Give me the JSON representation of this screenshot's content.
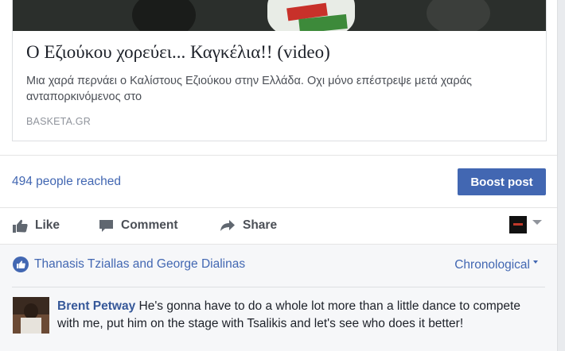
{
  "link_preview": {
    "title": "Ο Εζιούκου χορεύει... Καγκέλια!! (video)",
    "description": "Μια χαρά περνάει ο Καλίστους Εζιούκου στην Ελλάδα. Οχι μόνο επέστρεψε μετά χαράς ανταπορκινόμενος στο",
    "source": "BASKETA.GR"
  },
  "reach": {
    "text": "494 people reached",
    "boost_label": "Boost post"
  },
  "actions": [
    {
      "label": "Like",
      "icon": "thumbs-up-icon"
    },
    {
      "label": "Comment",
      "icon": "comment-icon"
    },
    {
      "label": "Share",
      "icon": "share-arrow-icon"
    }
  ],
  "likes": {
    "names": "Thanasis Tziallas and George Dialinas",
    "order_label": "Chronological"
  },
  "comments": [
    {
      "author": "Brent Petway",
      "text": "He's gonna have to do a whole lot more than a little dance to compete with me, put him on the stage with Tsalikis and let's see who does it better!"
    }
  ],
  "colors": {
    "accent": "#4267b2",
    "name_link": "#365899",
    "text": "#1d2129",
    "muted": "#90949c",
    "comments_bg": "#f6f7f9"
  }
}
